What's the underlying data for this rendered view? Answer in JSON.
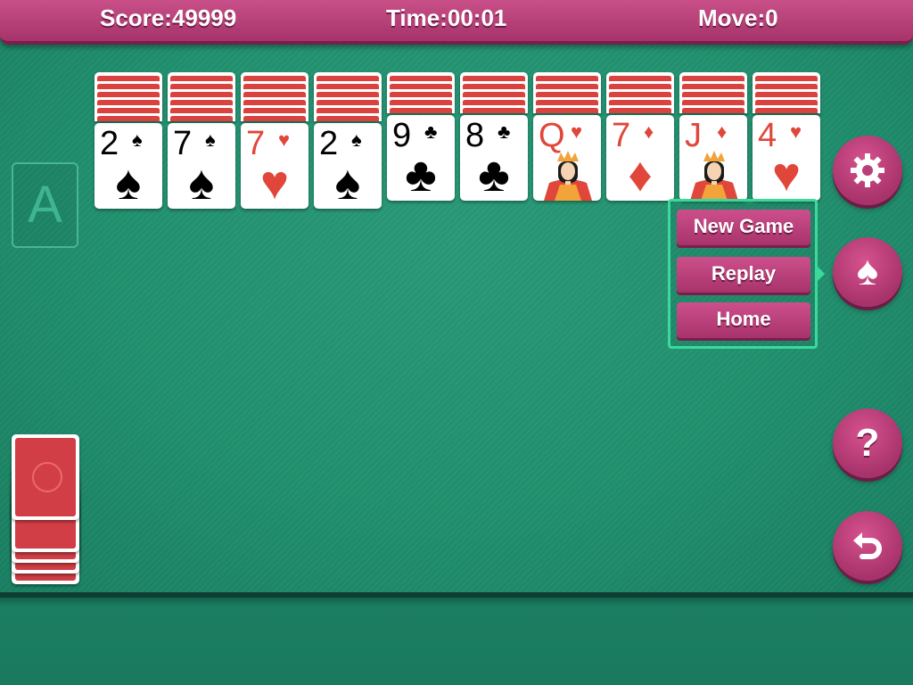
{
  "topbar": {
    "score": "Score:49999",
    "time": "Time:00:01",
    "move": "Move:0"
  },
  "foundation": {
    "label": "A"
  },
  "tableau": [
    {
      "rank": "2",
      "suit": "♠",
      "color": "black",
      "court": false
    },
    {
      "rank": "7",
      "suit": "♠",
      "color": "black",
      "court": false
    },
    {
      "rank": "7",
      "suit": "♥",
      "color": "red",
      "court": false
    },
    {
      "rank": "2",
      "suit": "♠",
      "color": "black",
      "court": false
    },
    {
      "rank": "9",
      "suit": "♣",
      "color": "black",
      "court": false
    },
    {
      "rank": "8",
      "suit": "♣",
      "color": "black",
      "court": false
    },
    {
      "rank": "Q",
      "suit": "♥",
      "color": "red",
      "court": true
    },
    {
      "rank": "7",
      "suit": "♦",
      "color": "red",
      "court": false
    },
    {
      "rank": "J",
      "suit": "♦",
      "color": "red",
      "court": true
    },
    {
      "rank": "4",
      "suit": "♥",
      "color": "red",
      "court": false
    }
  ],
  "menu": {
    "new_game": "New Game",
    "replay": "Replay",
    "home": "Home"
  },
  "buttons": [
    "settings-gear-icon",
    "spade-icon",
    "help-question-icon",
    "undo-icon"
  ],
  "colors": {
    "felt": "#21906e",
    "bar": "#b03d76",
    "card_back": "#d9423e",
    "highlight": "#3bd99c"
  }
}
